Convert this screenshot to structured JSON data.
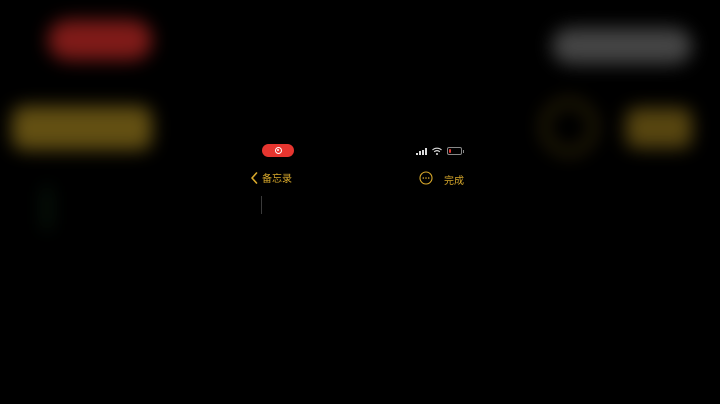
{
  "colors": {
    "accent": "#d9a92b",
    "record": "#e6352f",
    "background": "#000000"
  },
  "status_bar": {
    "record_icon": "screen-record-icon",
    "signal_icon": "cellular-signal-icon",
    "wifi_icon": "wifi-icon",
    "battery_icon": "battery-low-icon",
    "battery_level": 0.2
  },
  "nav": {
    "back_label": "备忘录",
    "back_icon": "chevron-left-icon",
    "more_icon": "ellipsis-circle-icon",
    "done_label": "完成"
  },
  "note": {
    "body": ""
  }
}
